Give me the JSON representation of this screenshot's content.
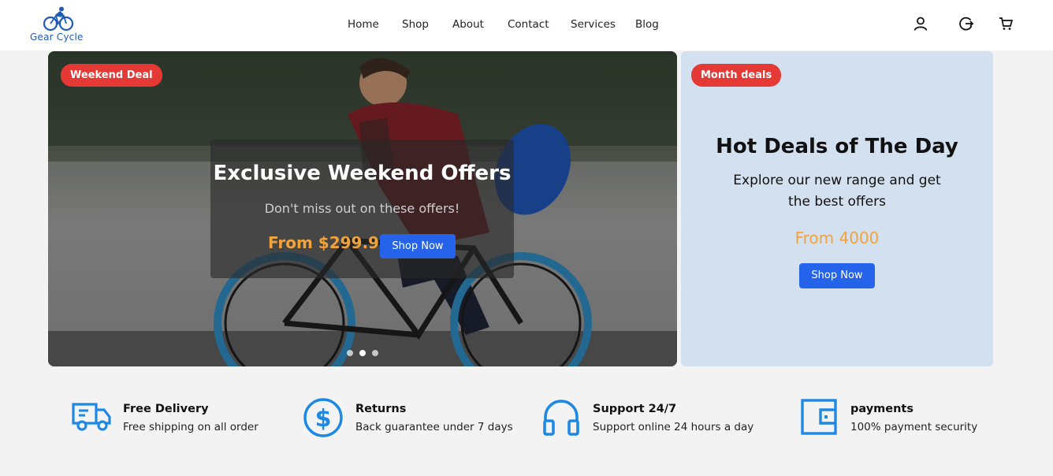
{
  "brand": {
    "name": "Gear Cycle",
    "logo_icon": "bicycle-rider-logo",
    "color": "#1e5bb8"
  },
  "nav": {
    "items": [
      {
        "label": "Home"
      },
      {
        "label": "Shop"
      },
      {
        "label": "About"
      },
      {
        "label": "Contact"
      },
      {
        "label": "Services"
      },
      {
        "label": "Blog"
      }
    ]
  },
  "header_icons": [
    "user-icon",
    "logout-icon",
    "cart-icon"
  ],
  "hero": {
    "badge": "Weekend Deal",
    "title": "Exclusive Weekend Offers",
    "subtitle": "Don't miss out on these offers!",
    "price": "From $299.99",
    "button": "Shop Now",
    "slides": 3,
    "active_slide": 2
  },
  "deal": {
    "badge": "Month deals",
    "title": "Hot Deals of The Day",
    "subtitle": "Explore our new range and get the best offers",
    "price": "From 4000",
    "button": "Shop Now"
  },
  "features": [
    {
      "icon": "truck-icon",
      "title": "Free Delivery",
      "desc": "Free shipping on all order"
    },
    {
      "icon": "dollar-icon",
      "title": "Returns",
      "desc": "Back guarantee under 7 days"
    },
    {
      "icon": "headphones-icon",
      "title": "Support 24/7",
      "desc": "Support online 24 hours a day"
    },
    {
      "icon": "wallet-icon",
      "title": "payments",
      "desc": "100% payment security"
    }
  ],
  "colors": {
    "accent": "#2563eb",
    "badge": "#e53935",
    "price": "#f0a33c",
    "feature_icon": "#1e88e5",
    "deal_panel": "#d3e0ef"
  }
}
